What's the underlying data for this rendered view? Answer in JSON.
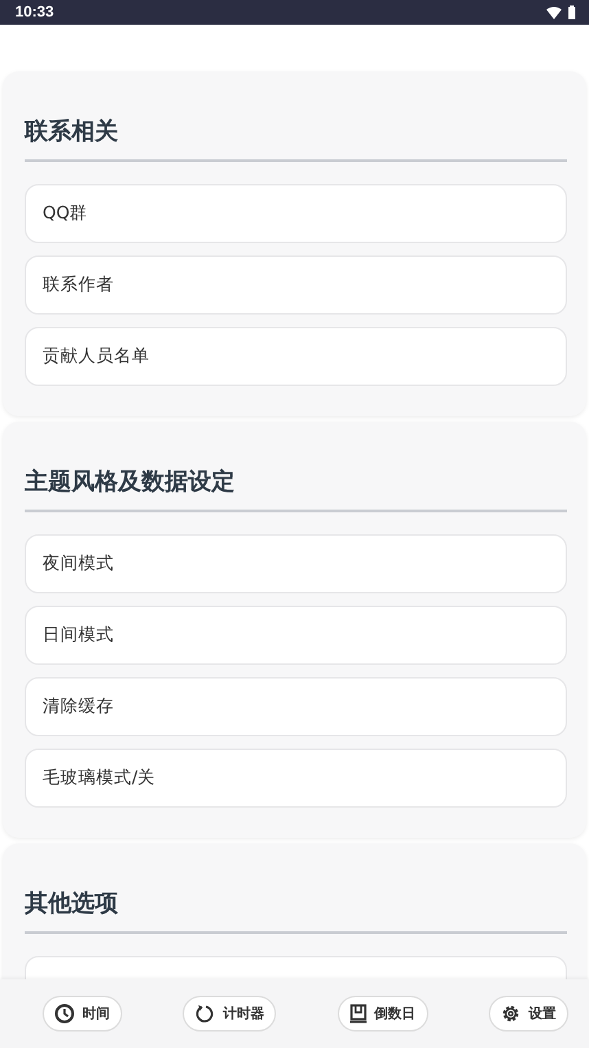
{
  "status_bar": {
    "time": "10:33"
  },
  "sections": [
    {
      "title": "联系相关",
      "items": [
        "QQ群",
        "联系作者",
        "贡献人员名单"
      ]
    },
    {
      "title": "主题风格及数据设定",
      "items": [
        "夜间模式",
        "日间模式",
        "清除缓存",
        "毛玻璃模式/关"
      ]
    },
    {
      "title": "其他选项"
    }
  ],
  "bottom_nav": [
    {
      "kind": "clock",
      "label": "时间"
    },
    {
      "kind": "timer",
      "label": "计时器"
    },
    {
      "kind": "calendar",
      "label": "倒数日"
    },
    {
      "kind": "settings",
      "label": "设置"
    }
  ]
}
